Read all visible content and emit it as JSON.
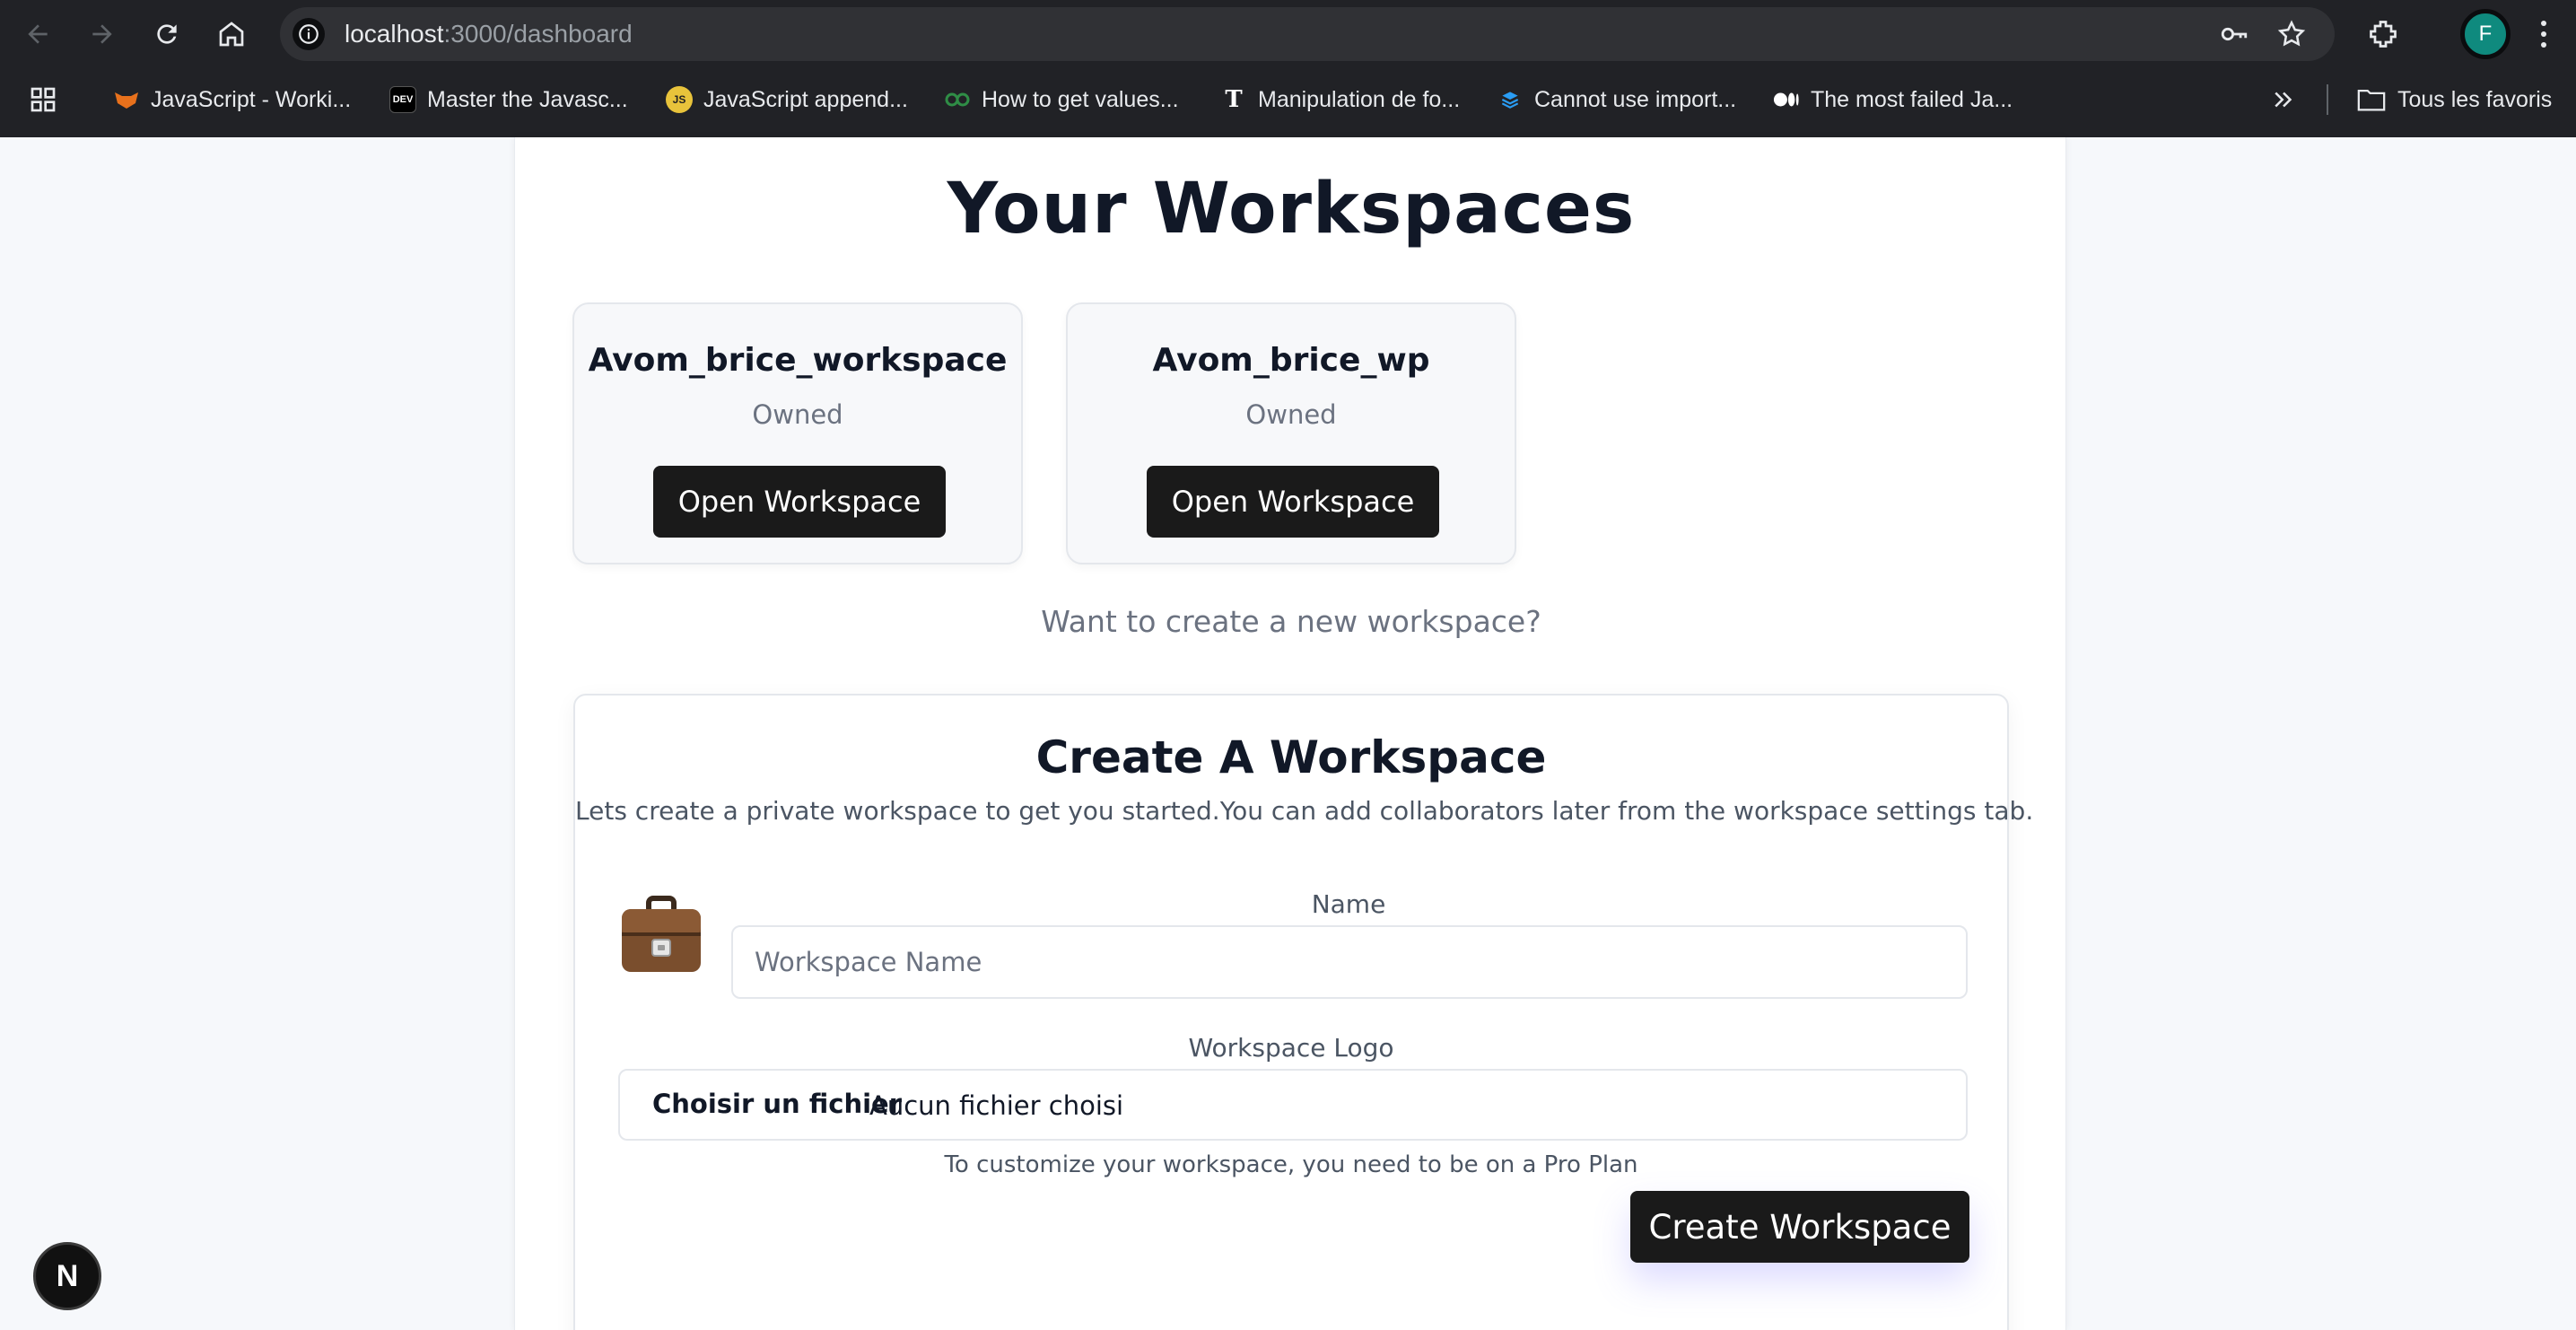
{
  "browser": {
    "url_host": "localhost",
    "url_path": ":3000/dashboard",
    "profile_initial": "F",
    "bookmarks": [
      {
        "label": "JavaScript - Worki...",
        "icon": "fox-icon",
        "color": "#e8711c"
      },
      {
        "label": "Master the Javasc...",
        "icon": "dev-icon",
        "color": "#000000"
      },
      {
        "label": "JavaScript append...",
        "icon": "js-icon",
        "color": "#e8c33b"
      },
      {
        "label": "How to get values...",
        "icon": "gfg-icon",
        "color": "#2f8d46"
      },
      {
        "label": "Manipulation de fo...",
        "icon": "t-icon",
        "color": "#ffffff"
      },
      {
        "label": "Cannot use import...",
        "icon": "stack-icon",
        "color": "#2a9df4"
      },
      {
        "label": "The most failed Ja...",
        "icon": "medium-icon",
        "color": "#ffffff"
      }
    ],
    "favorites_label": "Tous les favoris"
  },
  "page": {
    "title": "Your Workspaces",
    "workspaces": [
      {
        "name": "Avom_brice_workspace",
        "role": "Owned",
        "button": "Open Workspace"
      },
      {
        "name": "Avom_brice_wp",
        "role": "Owned",
        "button": "Open Workspace"
      }
    ],
    "prompt": "Want to create a new workspace?"
  },
  "create": {
    "title": "Create A Workspace",
    "description": "Lets create a private workspace to get you started.You can add collaborators later from the workspace settings tab.",
    "emoji": "💼",
    "name_label": "Name",
    "name_placeholder": "Workspace Name",
    "logo_label": "Workspace Logo",
    "file_button": "Choisir un fichier",
    "file_status": "Aucun fichier choisi",
    "pro_note": "To customize your workspace, you need to be on a Pro Plan",
    "submit": "Create Workspace"
  },
  "dev": {
    "badge": "N"
  }
}
